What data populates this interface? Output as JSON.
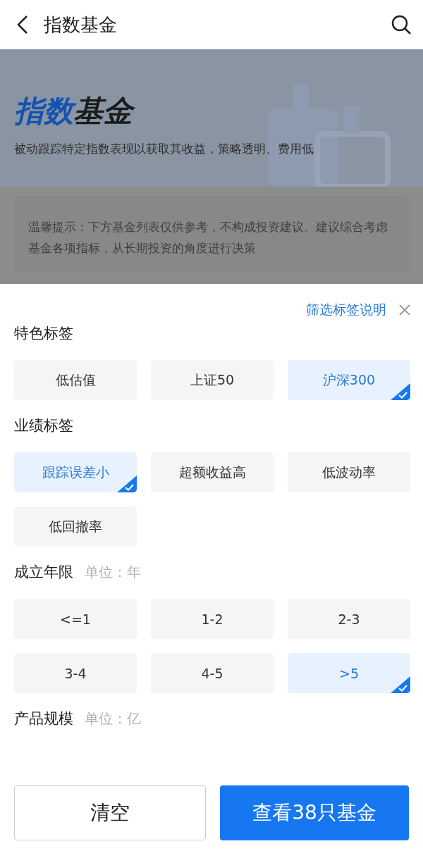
{
  "header": {
    "title": "指数基金"
  },
  "banner": {
    "title_accent": "指数",
    "title_rest": "基金",
    "subtitle": "被动跟踪特定指数表现以获取其收益，策略透明、费用低"
  },
  "notice": "温馨提示：下方基金列表仅供参考，不构成投资建议。建议综合考虑基金各项指标，从长期投资的角度进行决策",
  "sheet": {
    "help_link": "筛选标签说明",
    "sections": [
      {
        "title": "特色标签",
        "chips": [
          {
            "label": "低估值",
            "selected": false
          },
          {
            "label": "上证50",
            "selected": false
          },
          {
            "label": "沪深300",
            "selected": true
          }
        ]
      },
      {
        "title": "业绩标签",
        "chips": [
          {
            "label": "跟踪误差小",
            "selected": true
          },
          {
            "label": "超额收益高",
            "selected": false
          },
          {
            "label": "低波动率",
            "selected": false
          },
          {
            "label": "低回撤率",
            "selected": false
          }
        ]
      },
      {
        "title": "成立年限",
        "unit": "单位：年",
        "chips": [
          {
            "label": "<=1",
            "selected": false
          },
          {
            "label": "1-2",
            "selected": false
          },
          {
            "label": "2-3",
            "selected": false
          },
          {
            "label": "3-4",
            "selected": false
          },
          {
            "label": "4-5",
            "selected": false
          },
          {
            "label": ">5",
            "selected": true
          }
        ]
      },
      {
        "title": "产品规模",
        "unit": "单位：亿"
      }
    ]
  },
  "footer": {
    "clear": "清空",
    "confirm": "查看38只基金"
  }
}
